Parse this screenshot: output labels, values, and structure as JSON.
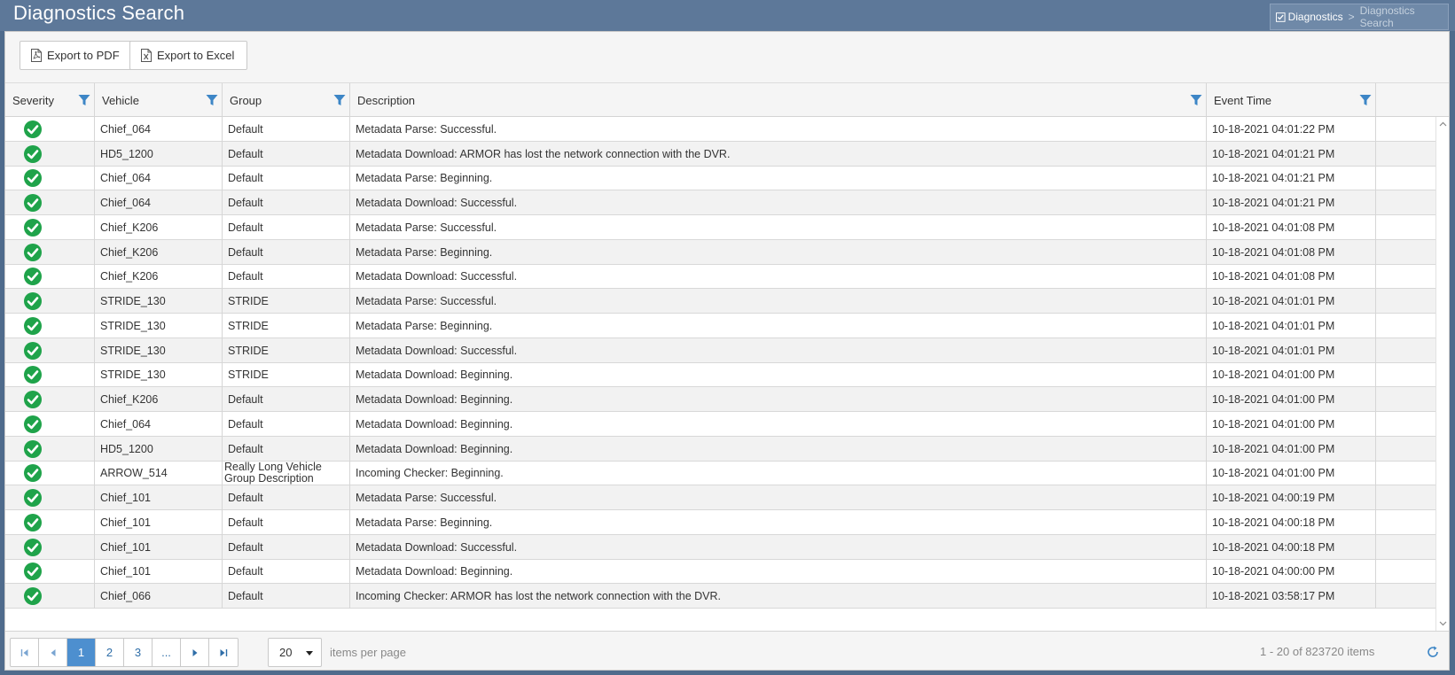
{
  "header": {
    "title": "Diagnostics Search",
    "breadcrumb": {
      "root": "Diagnostics",
      "separator": ">",
      "current": "Diagnostics Search"
    }
  },
  "toolbar": {
    "export_pdf_label": "Export to PDF",
    "export_excel_label": "Export to Excel"
  },
  "grid": {
    "columns": {
      "severity": "Severity",
      "vehicle": "Vehicle",
      "group": "Group",
      "description": "Description",
      "event_time": "Event Time"
    },
    "rows": [
      {
        "severity": "success",
        "vehicle": "Chief_064",
        "group": "Default",
        "description": "Metadata Parse: Successful.",
        "event_time": "10-18-2021 04:01:22 PM"
      },
      {
        "severity": "success",
        "vehicle": "HD5_1200",
        "group": "Default",
        "description": "Metadata Download: ARMOR has lost the network connection with the DVR.",
        "event_time": "10-18-2021 04:01:21 PM"
      },
      {
        "severity": "success",
        "vehicle": "Chief_064",
        "group": "Default",
        "description": "Metadata Parse: Beginning.",
        "event_time": "10-18-2021 04:01:21 PM"
      },
      {
        "severity": "success",
        "vehicle": "Chief_064",
        "group": "Default",
        "description": "Metadata Download: Successful.",
        "event_time": "10-18-2021 04:01:21 PM"
      },
      {
        "severity": "success",
        "vehicle": "Chief_K206",
        "group": "Default",
        "description": "Metadata Parse: Successful.",
        "event_time": "10-18-2021 04:01:08 PM"
      },
      {
        "severity": "success",
        "vehicle": "Chief_K206",
        "group": "Default",
        "description": "Metadata Parse: Beginning.",
        "event_time": "10-18-2021 04:01:08 PM"
      },
      {
        "severity": "success",
        "vehicle": "Chief_K206",
        "group": "Default",
        "description": "Metadata Download: Successful.",
        "event_time": "10-18-2021 04:01:08 PM"
      },
      {
        "severity": "success",
        "vehicle": "STRIDE_130",
        "group": "STRIDE",
        "description": "Metadata Parse: Successful.",
        "event_time": "10-18-2021 04:01:01 PM"
      },
      {
        "severity": "success",
        "vehicle": "STRIDE_130",
        "group": "STRIDE",
        "description": "Metadata Parse: Beginning.",
        "event_time": "10-18-2021 04:01:01 PM"
      },
      {
        "severity": "success",
        "vehicle": "STRIDE_130",
        "group": "STRIDE",
        "description": "Metadata Download: Successful.",
        "event_time": "10-18-2021 04:01:01 PM"
      },
      {
        "severity": "success",
        "vehicle": "STRIDE_130",
        "group": "STRIDE",
        "description": "Metadata Download: Beginning.",
        "event_time": "10-18-2021 04:01:00 PM"
      },
      {
        "severity": "success",
        "vehicle": "Chief_K206",
        "group": "Default",
        "description": "Metadata Download: Beginning.",
        "event_time": "10-18-2021 04:01:00 PM"
      },
      {
        "severity": "success",
        "vehicle": "Chief_064",
        "group": "Default",
        "description": "Metadata Download: Beginning.",
        "event_time": "10-18-2021 04:01:00 PM"
      },
      {
        "severity": "success",
        "vehicle": "HD5_1200",
        "group": "Default",
        "description": "Metadata Download: Beginning.",
        "event_time": "10-18-2021 04:01:00 PM"
      },
      {
        "severity": "success",
        "vehicle": "ARROW_514",
        "group": "Really Long Vehicle Group Description",
        "description": "Incoming Checker: Beginning.",
        "event_time": "10-18-2021 04:01:00 PM"
      },
      {
        "severity": "success",
        "vehicle": "Chief_101",
        "group": "Default",
        "description": "Metadata Parse: Successful.",
        "event_time": "10-18-2021 04:00:19 PM"
      },
      {
        "severity": "success",
        "vehicle": "Chief_101",
        "group": "Default",
        "description": "Metadata Parse: Beginning.",
        "event_time": "10-18-2021 04:00:18 PM"
      },
      {
        "severity": "success",
        "vehicle": "Chief_101",
        "group": "Default",
        "description": "Metadata Download: Successful.",
        "event_time": "10-18-2021 04:00:18 PM"
      },
      {
        "severity": "success",
        "vehicle": "Chief_101",
        "group": "Default",
        "description": "Metadata Download: Beginning.",
        "event_time": "10-18-2021 04:00:00 PM"
      },
      {
        "severity": "success",
        "vehicle": "Chief_066",
        "group": "Default",
        "description": "Incoming Checker: ARMOR has lost the network connection with the DVR.",
        "event_time": "10-18-2021 03:58:17 PM"
      }
    ]
  },
  "pager": {
    "pages": [
      "1",
      "2",
      "3",
      "..."
    ],
    "current_page": "1",
    "page_size": "20",
    "items_per_page_label": "items per page",
    "info": "1 - 20 of 823720 items"
  },
  "colors": {
    "header_bg": "#5d7899",
    "accent": "#4d8fcf",
    "filter_icon": "#3d86c6",
    "success": "#1fa34a"
  },
  "icons": {
    "severity_success": "check-circle-icon",
    "filter": "filter-funnel-icon",
    "pdf": "pdf-file-icon",
    "excel": "excel-file-icon",
    "refresh": "refresh-icon"
  }
}
